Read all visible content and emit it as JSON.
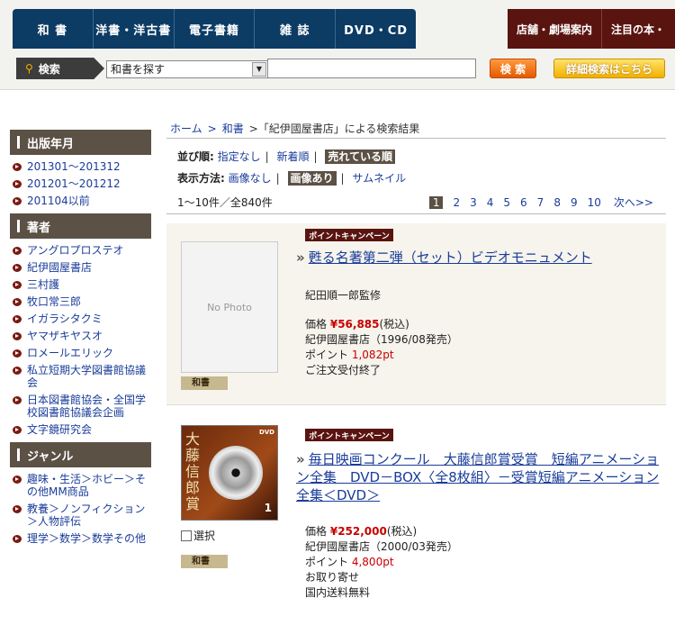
{
  "header": {
    "nav_tabs": [
      "和 書",
      "洋書・洋古書",
      "電子書籍",
      "雑 誌",
      "DVD・CD"
    ],
    "nav_right": [
      "店舗・劇場案内",
      "注目の本・"
    ],
    "search_label": "検索",
    "search_scope": "和書を探す",
    "search_value": "",
    "search_button": "検 索",
    "advanced_button": "詳細検索はこちら"
  },
  "sidebar": {
    "sections": [
      {
        "title": "出版年月",
        "items": [
          "201301〜201312",
          "201201〜201212",
          "201104以前"
        ]
      },
      {
        "title": "著者",
        "items": [
          "アングロプロステオ",
          "紀伊國屋書店",
          "三村護",
          "牧口常三郎",
          "イガラシタクミ",
          "ヤマザキヤスオ",
          "ロメールエリック",
          "私立短期大学図書館協議会",
          "日本図書館協会・全国学校図書館協議会企画",
          "文字鏡研究会"
        ]
      },
      {
        "title": "ジャンル",
        "items": [
          "趣味・生活＞ホビー＞その他MM商品",
          "教養＞ノンフィクション＞人物評伝",
          "理学＞数学＞数学その他"
        ]
      }
    ]
  },
  "main": {
    "breadcrumb": {
      "home": "ホーム",
      "sep": ">",
      "category": "和書",
      "current": ">「紀伊國屋書店」による検索結果"
    },
    "sort": {
      "label": "並び順:",
      "options": [
        "指定なし",
        "新着順",
        "売れている順"
      ]
    },
    "display": {
      "label": "表示方法:",
      "options": [
        "画像なし",
        "画像あり",
        "サムネイル"
      ]
    },
    "count": "1〜10件／全840件",
    "pages": [
      "1",
      "2",
      "3",
      "4",
      "5",
      "6",
      "7",
      "8",
      "9",
      "10"
    ],
    "next": "次へ>>",
    "results": [
      {
        "campaign": "ポイントキャンペーン",
        "title": "甦る名著第二弾（セット）ビデオモニュメント",
        "author": "紀田順一郎監修",
        "no_photo": "No Photo",
        "price_label": "価格",
        "price": "¥56,885",
        "tax": "(税込)",
        "publisher": "紀伊國屋書店（1996/08発売）",
        "points_label": "ポイント",
        "points": "1,082pt",
        "status": "ご注文受付終了",
        "category": "和書"
      },
      {
        "campaign": "ポイントキャンペーン",
        "title": "毎日映画コンクール　大藤信郎賞受賞　短編アニメーション全集　DVD－BOX〈全8枚組〉－受賞短編アニメーション全集＜DVD＞",
        "cover_text": "大藤信郎賞",
        "cover_num": "1",
        "select_label": "選択",
        "price_label": "価格",
        "price": "¥252,000",
        "tax": "(税込)",
        "publisher": "紀伊國屋書店（2000/03発売）",
        "points_label": "ポイント",
        "points": "4,800pt",
        "status": "お取り寄せ",
        "shipping": "国内送料無料",
        "category": "和書"
      }
    ]
  }
}
